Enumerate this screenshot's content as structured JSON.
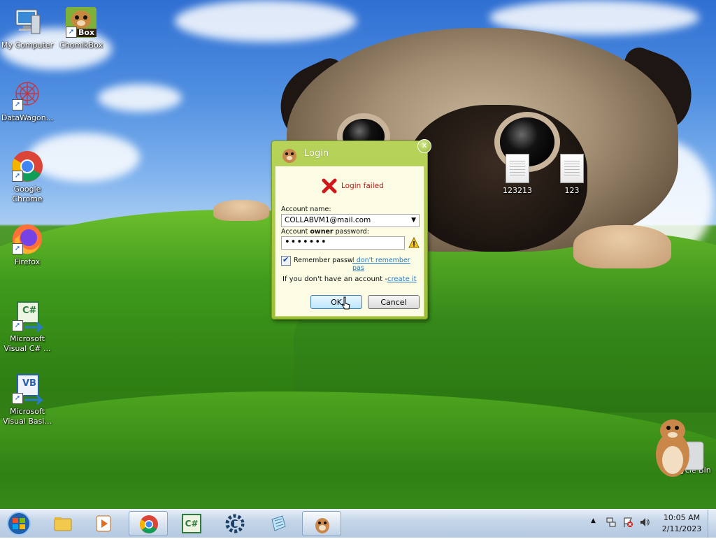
{
  "desktop": {
    "icons": [
      {
        "label": "My Computer",
        "icon": "computer-icon"
      },
      {
        "label": "ChomikBox",
        "icon": "chomikbox-icon",
        "badge": "Box"
      },
      {
        "label": "DataWagon...",
        "icon": "datawagon-icon"
      },
      {
        "label": "Google Chrome",
        "icon": "chrome-icon"
      },
      {
        "label": "Firefox",
        "icon": "firefox-icon"
      },
      {
        "label": "Microsoft Visual C# ...",
        "icon": "visual-csharp-icon",
        "badge": "C#"
      },
      {
        "label": "Microsoft Visual Basi...",
        "icon": "visual-basic-icon",
        "badge": "VB"
      }
    ],
    "files": [
      {
        "label": "123213",
        "icon": "text-file-icon"
      },
      {
        "label": "123",
        "icon": "text-file-icon"
      }
    ],
    "recycle_bin": {
      "label": "Recycle Bin",
      "icon": "hamster-recycle-bin-icon"
    }
  },
  "dialog": {
    "title": "Login",
    "close_label": "x",
    "error_text": "Login failed",
    "account_name_label": "Account name:",
    "account_name_value": "COLLABVM1@mail.com",
    "password_label_prefix": "Account ",
    "password_label_bold": "owner",
    "password_label_suffix": " password:",
    "password_value": "•••••••",
    "remember_label": "Remember passw",
    "remember_checked": true,
    "forgot_link": "I don't remember pas",
    "no_account_text": "If you don't have an account - ",
    "create_link": "create it",
    "ok_label": "OK",
    "cancel_label": "Cancel"
  },
  "taskbar": {
    "items": [
      {
        "name": "explorer",
        "icon": "folder-icon",
        "active": false
      },
      {
        "name": "media-player",
        "icon": "media-player-icon",
        "active": false
      },
      {
        "name": "chrome",
        "icon": "chrome-icon",
        "active": true
      },
      {
        "name": "visual-csharp",
        "icon": "visual-csharp-icon",
        "badge": "C#",
        "active": false
      },
      {
        "name": "cheat-engine",
        "icon": "gear-icon",
        "active": false
      },
      {
        "name": "notepad",
        "icon": "notepad-icon",
        "active": false
      },
      {
        "name": "chomikbox",
        "icon": "hamster-icon",
        "active": true
      }
    ],
    "tray": {
      "time": "10:05 AM",
      "date": "2/11/2023"
    }
  },
  "colors": {
    "dialog_green": "#9cbf35",
    "error_red": "#c01515",
    "link_blue": "#2a7ac0"
  }
}
